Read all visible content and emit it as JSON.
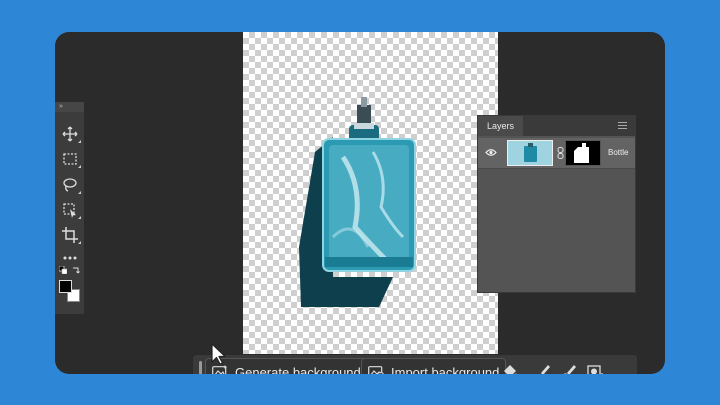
{
  "toolbar": {
    "collapse_glyph": "»",
    "tools": [
      {
        "name": "move-tool",
        "icon": "move-icon"
      },
      {
        "name": "marquee-tool",
        "icon": "rect-marquee-icon"
      },
      {
        "name": "lasso-tool",
        "icon": "lasso-icon"
      },
      {
        "name": "object-select-tool",
        "icon": "object-select-icon"
      },
      {
        "name": "crop-tool",
        "icon": "crop-icon"
      },
      {
        "name": "more-tools",
        "icon": "ellipsis-icon"
      }
    ],
    "foreground_color": "#000000",
    "background_color": "#ffffff"
  },
  "layers_panel": {
    "tab_label": "Layers",
    "layers": [
      {
        "name": "Bottle",
        "visible": true
      }
    ]
  },
  "contextual_bar": {
    "generate_label": "Generate background",
    "import_label": "Import background",
    "icons": [
      "paint-bucket-icon",
      "brush-icon",
      "eraser-brush-icon",
      "mask-icon",
      "more-icon"
    ]
  },
  "colors": {
    "page_background": "#2e86d6",
    "app_background": "#2b2b2b",
    "panel": "#545454",
    "accent_teal": "#1f8aa3"
  }
}
